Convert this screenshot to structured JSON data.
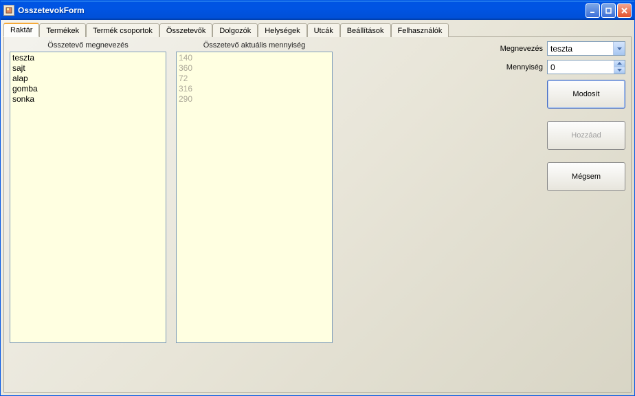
{
  "window": {
    "title": "OsszetevokForm"
  },
  "tabs": [
    {
      "label": "Raktár",
      "active": true
    },
    {
      "label": "Termékek",
      "active": false
    },
    {
      "label": "Termék csoportok",
      "active": false
    },
    {
      "label": "Összetevők",
      "active": false
    },
    {
      "label": "Dolgozók",
      "active": false
    },
    {
      "label": "Helységek",
      "active": false
    },
    {
      "label": "Utcák",
      "active": false
    },
    {
      "label": "Beállítások",
      "active": false
    },
    {
      "label": "Felhasználók",
      "active": false
    }
  ],
  "columns": {
    "name_header": "Összetevő megnevezés",
    "qty_header": "Összetevő aktuális mennyiség"
  },
  "items": [
    {
      "name": "teszta",
      "qty": "140"
    },
    {
      "name": "sajt",
      "qty": "360"
    },
    {
      "name": "alap",
      "qty": "72"
    },
    {
      "name": "gomba",
      "qty": "316"
    },
    {
      "name": "sonka",
      "qty": "290"
    }
  ],
  "form": {
    "name_label": "Megnevezés",
    "name_value": "teszta",
    "qty_label": "Mennyiség",
    "qty_value": "0"
  },
  "buttons": {
    "modify": "Modosít",
    "add": "Hozzáad",
    "cancel": "Mégsem"
  }
}
